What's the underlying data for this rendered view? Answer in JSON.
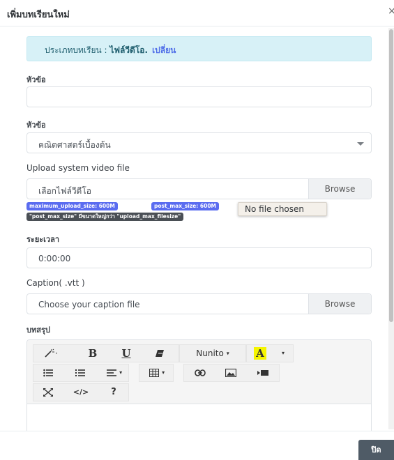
{
  "modal": {
    "title": "เพิ่มบทเรียนใหม่",
    "close_symbol": "×"
  },
  "alert": {
    "prefix": "ประเภทบทเรียน : ",
    "type": "ไฟล์วีดีโอ.",
    "change_link": "เปลี่ยน"
  },
  "form": {
    "title_label": "หัวข้อ",
    "title_value": "",
    "section_label": "หัวข้อ",
    "section_selected": "คณิตศาสตร์เบื้องต้น",
    "video_label": "Upload system video file",
    "video_placeholder": "เลือกไฟล์วีดีโอ",
    "video_browse": "Browse",
    "badge_upload": "maximum_upload_size: 600M",
    "badge_post": "post_max_size: 600M",
    "badge_note": "\"post_max_size\" มีขนาดใหญ่กว่า \"upload_max_filesize\"",
    "tooltip": "No file chosen",
    "duration_label": "ระยะเวลา",
    "duration_value": "0:00:00",
    "caption_label": "Caption( .vtt )",
    "caption_placeholder": "Choose your caption file",
    "caption_browse": "Browse",
    "summary_label": "บทสรุป"
  },
  "editor": {
    "toolbar": {
      "magic": "magic-wand-icon",
      "bold": "B",
      "underline": "U",
      "eraser": "eraser-icon",
      "font_name": "Nunito",
      "color_letter": "A",
      "color_highlight": "#f5f500",
      "unordered_list": "unordered-list-icon",
      "ordered_list": "ordered-list-icon",
      "paragraph": "align-icon",
      "table": "table-icon",
      "link": "link-icon",
      "picture": "picture-icon",
      "video": "video-icon",
      "fullscreen": "fullscreen-icon",
      "codeview": "</>",
      "help": "?"
    }
  },
  "footer": {
    "close_label": "ปิด"
  }
}
